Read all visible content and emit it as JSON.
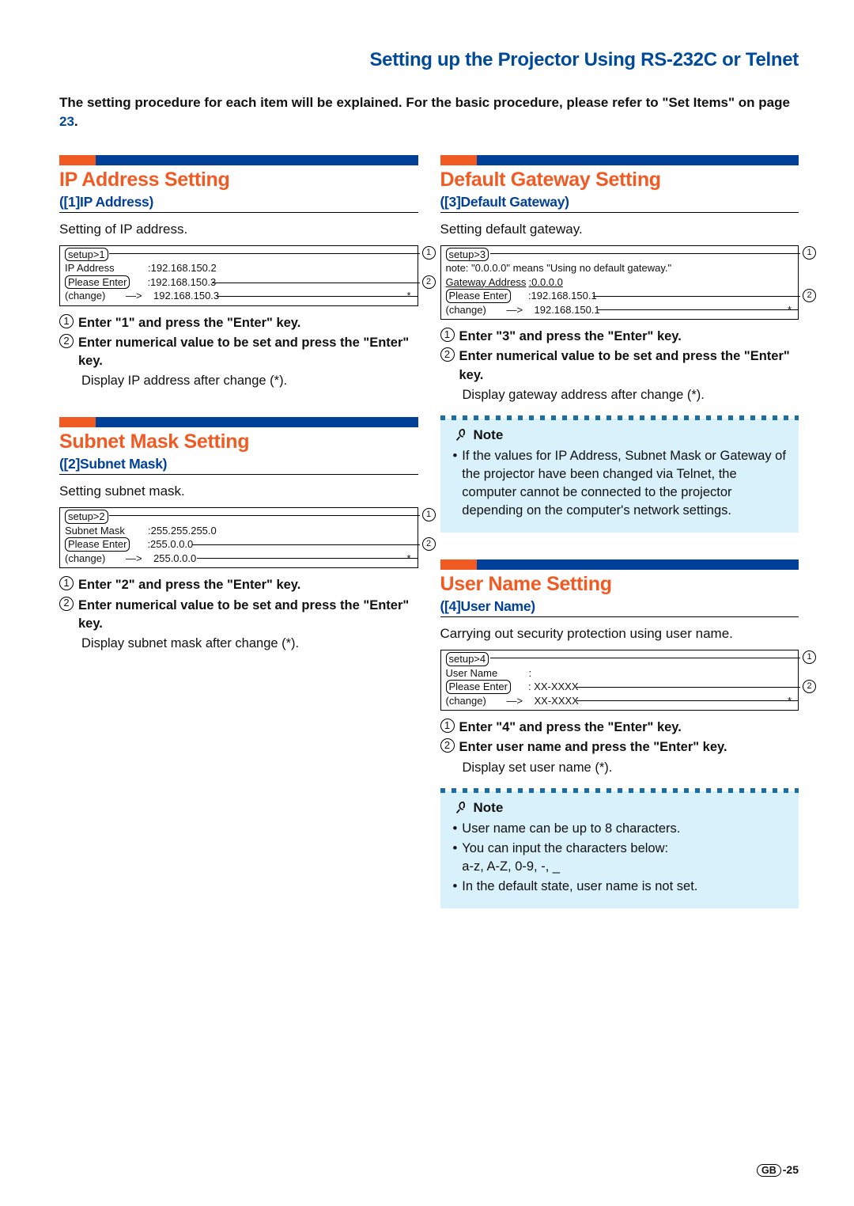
{
  "header": {
    "title": "Setting up the Projector Using RS-232C or Telnet"
  },
  "intro": {
    "text_a": "The setting procedure for each item will be explained. For the basic procedure, please refer to \"Set Items\" on page ",
    "page_link": "23",
    "text_b": "."
  },
  "sections": {
    "ip": {
      "title": "IP Address Setting",
      "sub": "([1]IP Address)",
      "desc": "Setting of IP address.",
      "terminal": {
        "setup": "setup>1",
        "row1_label": "IP Address",
        "row1_val": ":192.168.150.2",
        "row2_label": "Please Enter",
        "row2_val": ":192.168.150.3",
        "row3_label": "(change)",
        "row3_arrow": "—>",
        "row3_val": "192.168.150.3",
        "star": "*"
      },
      "steps": {
        "s1": "Enter \"1\" and press the \"Enter\" key.",
        "s2": "Enter numerical value to be set and press the \"Enter\" key.",
        "after": "Display IP address after change (*)."
      }
    },
    "subnet": {
      "title": "Subnet Mask Setting",
      "sub": "([2]Subnet Mask)",
      "desc": "Setting subnet mask.",
      "terminal": {
        "setup": "setup>2",
        "row1_label": "Subnet Mask",
        "row1_val": ":255.255.255.0",
        "row2_label": "Please Enter",
        "row2_val": ":255.0.0.0",
        "row3_label": "(change)",
        "row3_arrow": "—>",
        "row3_val": "255.0.0.0",
        "star": "*"
      },
      "steps": {
        "s1": "Enter \"2\" and press the \"Enter\" key.",
        "s2": "Enter numerical value to be set and press the \"Enter\" key.",
        "after": "Display subnet mask after change (*)."
      }
    },
    "gateway": {
      "title": "Default Gateway Setting",
      "sub": "([3]Default Gateway)",
      "desc": "Setting default gateway.",
      "terminal": {
        "setup": "setup>3",
        "note": "note: \"0.0.0.0\" means \"Using no default gateway.\"",
        "row1_label": "Gateway Address",
        "row1_val": ":0.0.0.0",
        "row2_label": "Please Enter",
        "row2_val": ":192.168.150.1",
        "row3_label": "(change)",
        "row3_arrow": "—>",
        "row3_val": "192.168.150.1",
        "star": "*"
      },
      "steps": {
        "s1": "Enter \"3\" and press the \"Enter\" key.",
        "s2": "Enter numerical value to be set and press the \"Enter\" key.",
        "after": "Display gateway address after change (*)."
      },
      "note": {
        "label": "Note",
        "items": [
          "If the values for IP Address, Subnet Mask or Gateway of the projector have been changed via Telnet, the computer cannot be connected to the projector depending on the computer's network settings."
        ]
      }
    },
    "user": {
      "title": "User Name Setting",
      "sub": "([4]User Name)",
      "desc": "Carrying out security protection using user name.",
      "terminal": {
        "setup": "setup>4",
        "row1_label": "User Name",
        "row1_val": ":",
        "row2_label": "Please Enter",
        "row2_val": ": XX-XXXX",
        "row3_label": "(change)",
        "row3_arrow": "—>",
        "row3_val": "XX-XXXX",
        "star": "*"
      },
      "steps": {
        "s1": "Enter \"4\" and press the \"Enter\" key.",
        "s2": "Enter user name and press the \"Enter\" key.",
        "after": "Display set user name (*)."
      },
      "note": {
        "label": "Note",
        "items": [
          "User name can be up to 8 characters.",
          "You can input the characters below:\na-z, A-Z, 0-9, -, _",
          "In the default state, user name is not set."
        ]
      }
    }
  },
  "footer": {
    "region": "GB",
    "page": "-25"
  }
}
